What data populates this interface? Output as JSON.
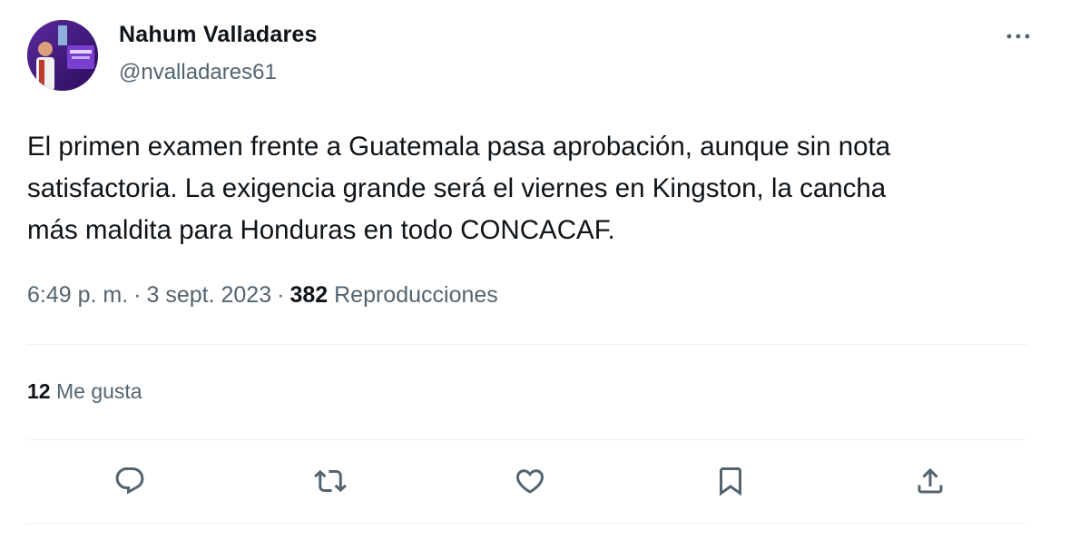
{
  "author": {
    "name": "Nahum Valladares",
    "handle": "@nvalladares61"
  },
  "tweet": {
    "lines": [
      "El primen examen frente a Guatemala pasa aprobación, aunque sin nota",
      "satisfactoria. La exigencia grande será el viernes en Kingston, la cancha",
      "más maldita para Honduras en todo CONCACAF."
    ]
  },
  "meta": {
    "time": "6:49 p. m.",
    "separator": "·",
    "date": "3 sept. 2023",
    "views_count": "382",
    "views_label": "Reproducciones"
  },
  "stats": {
    "likes_count": "12",
    "likes_label": "Me gusta"
  },
  "icons": {
    "more": "more-icon",
    "reply": "reply-icon",
    "retweet": "retweet-icon",
    "like": "heart-icon",
    "bookmark": "bookmark-icon",
    "share": "share-icon"
  },
  "colors": {
    "text_primary": "#0f1419",
    "text_secondary": "#536471",
    "divider": "#eff3f4"
  }
}
